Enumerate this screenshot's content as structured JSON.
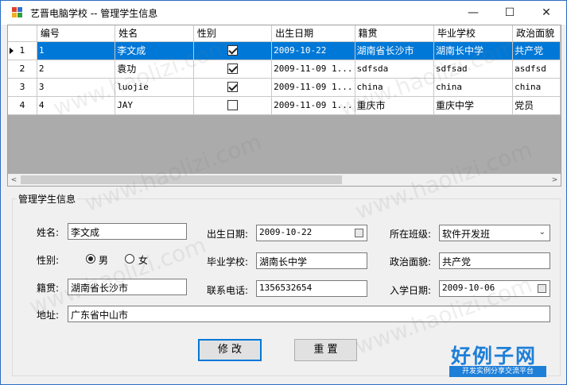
{
  "window": {
    "title": "艺晋电脑学校 -- 管理学生信息",
    "min": "—",
    "max": "☐",
    "close": "✕"
  },
  "grid": {
    "columns": [
      "编号",
      "姓名",
      "性别",
      "出生日期",
      "籍贯",
      "毕业学校",
      "政治面貌"
    ],
    "rows": [
      {
        "num": "1",
        "id": "1",
        "name": "李文成",
        "gender_checked": true,
        "birth": "2009-10-22",
        "native": "湖南省长沙市",
        "school": "湖南长中学",
        "politics": "共产党",
        "selected": true
      },
      {
        "num": "2",
        "id": "2",
        "name": "袁功",
        "gender_checked": true,
        "birth": "2009-11-09 1...",
        "native": "sdfsda",
        "school": "sdfsad",
        "politics": "asdfsd",
        "selected": false
      },
      {
        "num": "3",
        "id": "3",
        "name": "luojie",
        "gender_checked": true,
        "birth": "2009-11-09 1...",
        "native": "china",
        "school": "china",
        "politics": "china",
        "selected": false
      },
      {
        "num": "4",
        "id": "4",
        "name": "JAY",
        "gender_checked": false,
        "birth": "2009-11-09 1...",
        "native": "重庆市",
        "school": "重庆中学",
        "politics": "党员",
        "selected": false
      }
    ],
    "scroll_left": "<",
    "scroll_right": ">"
  },
  "form": {
    "group_title": "管理学生信息",
    "name_label": "姓名:",
    "name_value": "李文成",
    "gender_label": "性别:",
    "male_label": "男",
    "female_label": "女",
    "male_selected": true,
    "native_label": "籍贯:",
    "native_value": "湖南省长沙市",
    "address_label": "地址:",
    "address_value": "广东省中山市",
    "birth_label": "出生日期:",
    "birth_value": "2009-10-22",
    "school_label": "毕业学校:",
    "school_value": "湖南长中学",
    "phone_label": "联系电话:",
    "phone_value": "1356532654",
    "class_label": "所在班级:",
    "class_value": "软件开发班",
    "politics_label": "政治面貌:",
    "politics_value": "共产党",
    "enroll_label": "入学日期:",
    "enroll_value": "2009-10-06",
    "modify_button": "修 改",
    "reset_button": "重 置"
  },
  "watermark": {
    "text": "www.haolizi.com",
    "logo_big": "好例子网",
    "logo_small": "开发实例分享交流平台"
  },
  "colors": {
    "selection": "#0078d7",
    "logo": "#1e7fd8"
  }
}
